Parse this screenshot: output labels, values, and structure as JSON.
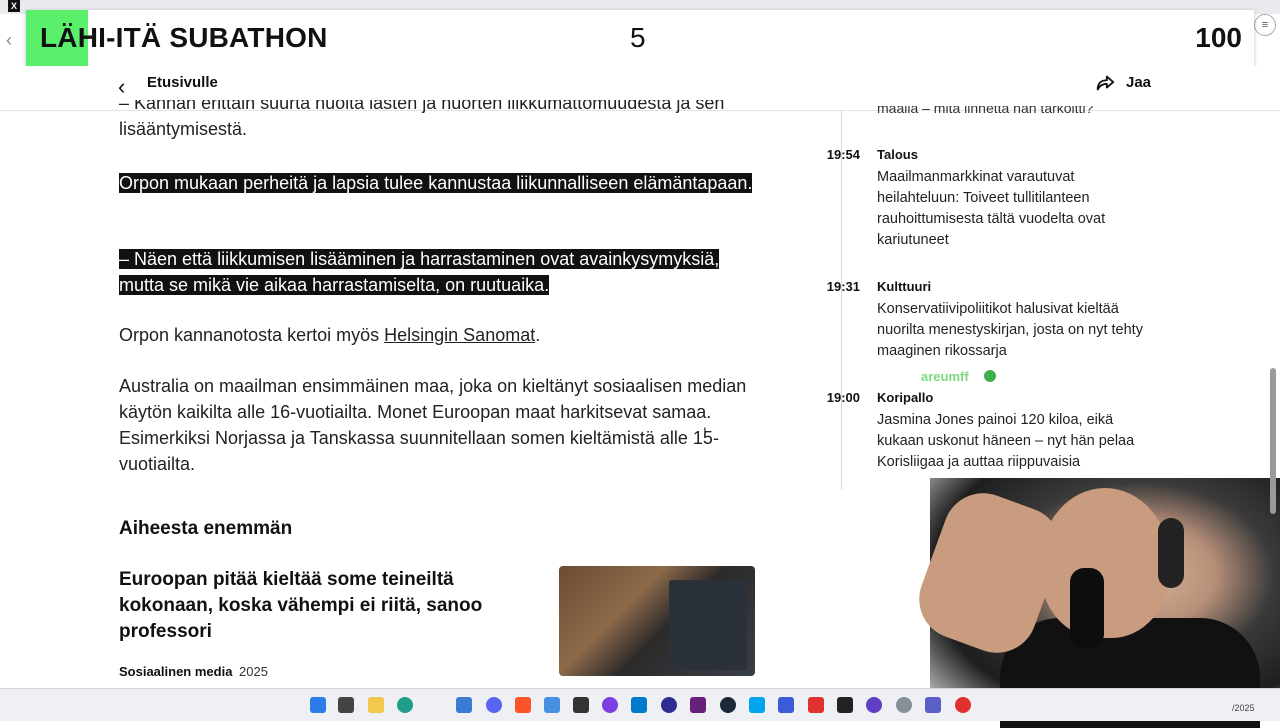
{
  "overlay": {
    "title": "LÄHI-ITÄ SUBATHON",
    "count": "5",
    "goal": "100"
  },
  "nav": {
    "back_label": "Etusivulle",
    "share_label": "Jaa"
  },
  "article": {
    "intro": "– Kannan erittäin suurta huolta lasten ja nuorten liikkumattomuudesta ja sen lisääntymisestä.",
    "highlight1": "Orpon mukaan perheitä ja lapsia tulee kannustaa liikunnalliseen elämäntapaan.",
    "highlight2": "– Näen että liikkumisen lisääminen ja harrastaminen ovat avainkysymyksiä, mutta se mikä vie aikaa harrastamiselta, on ruutuaika.",
    "source_prefix": "Orpon kannanotosta kertoi myös ",
    "source_link": "Helsingin Sanomat",
    "source_suffix": ".",
    "australia": "Australia on maailman ensimmäinen maa, joka on kieltänyt sosiaalisen median käytön kaikilta alle 16-vuotiailta. Monet Euroopan maat harkitsevat samaa. Esimerkiksi Norjassa ja Tanskassa suunnitellaan somen kieltämistä alle 15-vuotiailta."
  },
  "related": {
    "heading": "Aiheesta enemmän",
    "title": "Euroopan pitää kieltää some teineiltä kokonaan, koska vähempi ei riitä, sanoo professori",
    "category": "Sosiaalinen media",
    "year": "2025"
  },
  "feed": {
    "top_fragment": "maalla – mitä linnetta hän tarkoitti?",
    "items": [
      {
        "time": "19:54",
        "category": "Talous",
        "headline": "Maailmanmarkkinat varautuvat heilahteluun: Toiveet tullitilanteen rauhoittumisesta tältä vuodelta ovat kariutuneet"
      },
      {
        "time": "19:31",
        "category": "Kulttuuri",
        "headline": "Konservatiivipoliitikot halusivat kieltää nuorilta menestyskirjan, josta on nyt tehty maaginen rikossarja"
      },
      {
        "time": "19:00",
        "category": "Koripallo",
        "headline": "Jasmina Jones painoi 120 kiloa, eikä kukaan uskonut häneen – nyt hän pelaa Korisliigaa ja auttaa riippuvaisia"
      }
    ]
  },
  "stream": {
    "cam_tag": "areumff"
  },
  "taskbar": {
    "clock": "/2025"
  },
  "colors": {
    "overlay_accent": "#5af06c",
    "highlight_bg": "#111111"
  }
}
